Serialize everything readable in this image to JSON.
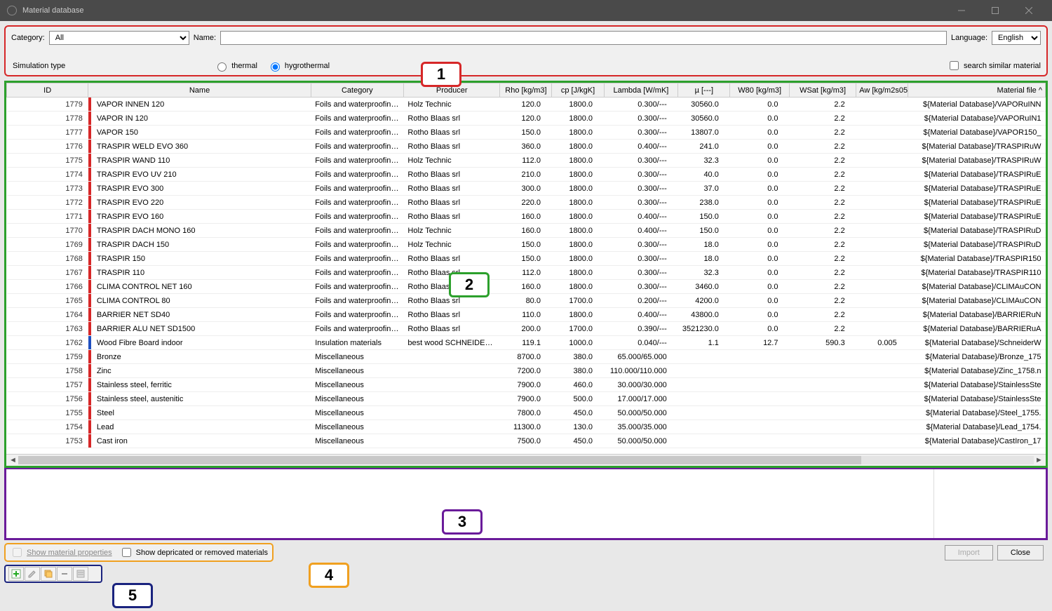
{
  "window": {
    "title": "Material database"
  },
  "filters": {
    "category_label": "Category:",
    "category_value": "All",
    "name_label": "Name:",
    "name_value": "",
    "language_label": "Language:",
    "language_value": "English",
    "simtype_label": "Simulation type",
    "radio_thermal": "thermal",
    "radio_hygrothermal": "hygrothermal",
    "search_similar": "search similar material"
  },
  "callouts": {
    "c1": "1",
    "c2": "2",
    "c3": "3",
    "c4": "4",
    "c5": "5"
  },
  "columns": [
    "ID",
    "Name",
    "Category",
    "Producer",
    "Rho [kg/m3]",
    "cp [J/kgK]",
    "Lambda [W/mK]",
    "µ [---]",
    "W80 [kg/m3]",
    "WSat [kg/m3]",
    "Aw [kg/m2s05]",
    "Material file"
  ],
  "rows": [
    {
      "id": "1779",
      "bar": "#d62728",
      "name": "VAPOR INNEN 120",
      "cat": "Foils and waterproofing ...",
      "prod": "Holz Technic",
      "rho": "120.0",
      "cp": "1800.0",
      "lam": "0.300/---",
      "mu": "30560.0",
      "w80": "0.0",
      "wsat": "2.2",
      "aw": "",
      "file": "${Material Database}/VAPORuINN"
    },
    {
      "id": "1778",
      "bar": "#d62728",
      "name": "VAPOR IN 120",
      "cat": "Foils and waterproofing ...",
      "prod": "Rotho Blaas srl",
      "rho": "120.0",
      "cp": "1800.0",
      "lam": "0.300/---",
      "mu": "30560.0",
      "w80": "0.0",
      "wsat": "2.2",
      "aw": "",
      "file": "${Material Database}/VAPORuIN1"
    },
    {
      "id": "1777",
      "bar": "#d62728",
      "name": "VAPOR 150",
      "cat": "Foils and waterproofing ...",
      "prod": "Rotho Blaas srl",
      "rho": "150.0",
      "cp": "1800.0",
      "lam": "0.300/---",
      "mu": "13807.0",
      "w80": "0.0",
      "wsat": "2.2",
      "aw": "",
      "file": "${Material Database}/VAPOR150_"
    },
    {
      "id": "1776",
      "bar": "#d62728",
      "name": "TRASPIR WELD EVO 360",
      "cat": "Foils and waterproofing ...",
      "prod": "Rotho Blaas srl",
      "rho": "360.0",
      "cp": "1800.0",
      "lam": "0.400/---",
      "mu": "241.0",
      "w80": "0.0",
      "wsat": "2.2",
      "aw": "",
      "file": "${Material Database}/TRASPIRuW"
    },
    {
      "id": "1775",
      "bar": "#d62728",
      "name": "TRASPIR WAND 110",
      "cat": "Foils and waterproofing ...",
      "prod": "Holz Technic",
      "rho": "112.0",
      "cp": "1800.0",
      "lam": "0.300/---",
      "mu": "32.3",
      "w80": "0.0",
      "wsat": "2.2",
      "aw": "",
      "file": "${Material Database}/TRASPIRuW"
    },
    {
      "id": "1774",
      "bar": "#d62728",
      "name": "TRASPIR EVO UV 210",
      "cat": "Foils and waterproofing ...",
      "prod": "Rotho Blaas srl",
      "rho": "210.0",
      "cp": "1800.0",
      "lam": "0.300/---",
      "mu": "40.0",
      "w80": "0.0",
      "wsat": "2.2",
      "aw": "",
      "file": "${Material Database}/TRASPIRuE"
    },
    {
      "id": "1773",
      "bar": "#d62728",
      "name": "TRASPIR EVO 300",
      "cat": "Foils and waterproofing ...",
      "prod": "Rotho Blaas srl",
      "rho": "300.0",
      "cp": "1800.0",
      "lam": "0.300/---",
      "mu": "37.0",
      "w80": "0.0",
      "wsat": "2.2",
      "aw": "",
      "file": "${Material Database}/TRASPIRuE"
    },
    {
      "id": "1772",
      "bar": "#d62728",
      "name": "TRASPIR EVO 220",
      "cat": "Foils and waterproofing ...",
      "prod": "Rotho Blaas srl",
      "rho": "220.0",
      "cp": "1800.0",
      "lam": "0.300/---",
      "mu": "238.0",
      "w80": "0.0",
      "wsat": "2.2",
      "aw": "",
      "file": "${Material Database}/TRASPIRuE"
    },
    {
      "id": "1771",
      "bar": "#d62728",
      "name": "TRASPIR EVO 160",
      "cat": "Foils and waterproofing ...",
      "prod": "Rotho Blaas srl",
      "rho": "160.0",
      "cp": "1800.0",
      "lam": "0.400/---",
      "mu": "150.0",
      "w80": "0.0",
      "wsat": "2.2",
      "aw": "",
      "file": "${Material Database}/TRASPIRuE"
    },
    {
      "id": "1770",
      "bar": "#d62728",
      "name": "TRASPIR DACH MONO 160",
      "cat": "Foils and waterproofing ...",
      "prod": "Holz Technic",
      "rho": "160.0",
      "cp": "1800.0",
      "lam": "0.400/---",
      "mu": "150.0",
      "w80": "0.0",
      "wsat": "2.2",
      "aw": "",
      "file": "${Material Database}/TRASPIRuD"
    },
    {
      "id": "1769",
      "bar": "#d62728",
      "name": "TRASPIR DACH 150",
      "cat": "Foils and waterproofing ...",
      "prod": "Holz Technic",
      "rho": "150.0",
      "cp": "1800.0",
      "lam": "0.300/---",
      "mu": "18.0",
      "w80": "0.0",
      "wsat": "2.2",
      "aw": "",
      "file": "${Material Database}/TRASPIRuD"
    },
    {
      "id": "1768",
      "bar": "#d62728",
      "name": "TRASPIR 150",
      "cat": "Foils and waterproofing ...",
      "prod": "Rotho Blaas srl",
      "rho": "150.0",
      "cp": "1800.0",
      "lam": "0.300/---",
      "mu": "18.0",
      "w80": "0.0",
      "wsat": "2.2",
      "aw": "",
      "file": "${Material Database}/TRASPIR150"
    },
    {
      "id": "1767",
      "bar": "#d62728",
      "name": "TRASPIR 110",
      "cat": "Foils and waterproofing ...",
      "prod": "Rotho Blaas srl",
      "rho": "112.0",
      "cp": "1800.0",
      "lam": "0.300/---",
      "mu": "32.3",
      "w80": "0.0",
      "wsat": "2.2",
      "aw": "",
      "file": "${Material Database}/TRASPIR110"
    },
    {
      "id": "1766",
      "bar": "#d62728",
      "name": "CLIMA CONTROL NET 160",
      "cat": "Foils and waterproofing ...",
      "prod": "Rotho Blaas srl",
      "rho": "160.0",
      "cp": "1800.0",
      "lam": "0.300/---",
      "mu": "3460.0",
      "w80": "0.0",
      "wsat": "2.2",
      "aw": "",
      "file": "${Material Database}/CLIMAuCON"
    },
    {
      "id": "1765",
      "bar": "#d62728",
      "name": "CLIMA CONTROL 80",
      "cat": "Foils and waterproofing ...",
      "prod": "Rotho Blaas srl",
      "rho": "80.0",
      "cp": "1700.0",
      "lam": "0.200/---",
      "mu": "4200.0",
      "w80": "0.0",
      "wsat": "2.2",
      "aw": "",
      "file": "${Material Database}/CLIMAuCON"
    },
    {
      "id": "1764",
      "bar": "#d62728",
      "name": "BARRIER NET SD40",
      "cat": "Foils and waterproofing ...",
      "prod": "Rotho Blaas srl",
      "rho": "110.0",
      "cp": "1800.0",
      "lam": "0.400/---",
      "mu": "43800.0",
      "w80": "0.0",
      "wsat": "2.2",
      "aw": "",
      "file": "${Material Database}/BARRIERuN"
    },
    {
      "id": "1763",
      "bar": "#d62728",
      "name": "BARRIER ALU NET SD1500",
      "cat": "Foils and waterproofing ...",
      "prod": "Rotho Blaas srl",
      "rho": "200.0",
      "cp": "1700.0",
      "lam": "0.390/---",
      "mu": "3521230.0",
      "w80": "0.0",
      "wsat": "2.2",
      "aw": "",
      "file": "${Material Database}/BARRIERuA"
    },
    {
      "id": "1762",
      "bar": "#1f4fbf",
      "name": "Wood Fibre Board indoor",
      "cat": "Insulation materials",
      "prod": "best wood SCHNEIDER...",
      "rho": "119.1",
      "cp": "1000.0",
      "lam": "0.040/---",
      "mu": "1.1",
      "w80": "12.7",
      "wsat": "590.3",
      "aw": "0.005",
      "file": "${Material Database}/SchneiderW"
    },
    {
      "id": "1759",
      "bar": "#d62728",
      "name": "Bronze",
      "cat": "Miscellaneous",
      "prod": "",
      "rho": "8700.0",
      "cp": "380.0",
      "lam": "65.000/65.000",
      "mu": "",
      "w80": "",
      "wsat": "",
      "aw": "",
      "file": "${Material Database}/Bronze_175"
    },
    {
      "id": "1758",
      "bar": "#d62728",
      "name": "Zinc",
      "cat": "Miscellaneous",
      "prod": "",
      "rho": "7200.0",
      "cp": "380.0",
      "lam": "110.000/110.000",
      "mu": "",
      "w80": "",
      "wsat": "",
      "aw": "",
      "file": "${Material Database}/Zinc_1758.n"
    },
    {
      "id": "1757",
      "bar": "#d62728",
      "name": "Stainless steel, ferritic",
      "cat": "Miscellaneous",
      "prod": "",
      "rho": "7900.0",
      "cp": "460.0",
      "lam": "30.000/30.000",
      "mu": "",
      "w80": "",
      "wsat": "",
      "aw": "",
      "file": "${Material Database}/StainlessSte"
    },
    {
      "id": "1756",
      "bar": "#d62728",
      "name": "Stainless steel, austenitic",
      "cat": "Miscellaneous",
      "prod": "",
      "rho": "7900.0",
      "cp": "500.0",
      "lam": "17.000/17.000",
      "mu": "",
      "w80": "",
      "wsat": "",
      "aw": "",
      "file": "${Material Database}/StainlessSte"
    },
    {
      "id": "1755",
      "bar": "#d62728",
      "name": "Steel",
      "cat": "Miscellaneous",
      "prod": "",
      "rho": "7800.0",
      "cp": "450.0",
      "lam": "50.000/50.000",
      "mu": "",
      "w80": "",
      "wsat": "",
      "aw": "",
      "file": "${Material Database}/Steel_1755."
    },
    {
      "id": "1754",
      "bar": "#d62728",
      "name": "Lead",
      "cat": "Miscellaneous",
      "prod": "",
      "rho": "11300.0",
      "cp": "130.0",
      "lam": "35.000/35.000",
      "mu": "",
      "w80": "",
      "wsat": "",
      "aw": "",
      "file": "${Material Database}/Lead_1754."
    },
    {
      "id": "1753",
      "bar": "#d62728",
      "name": "Cast iron",
      "cat": "Miscellaneous",
      "prod": "",
      "rho": "7500.0",
      "cp": "450.0",
      "lam": "50.000/50.000",
      "mu": "",
      "w80": "",
      "wsat": "",
      "aw": "",
      "file": "${Material Database}/CastIron_17"
    }
  ],
  "bottom": {
    "show_props": "Show material properties",
    "show_deprecated": "Show depricated or removed materials",
    "import": "Import",
    "close": "Close"
  }
}
